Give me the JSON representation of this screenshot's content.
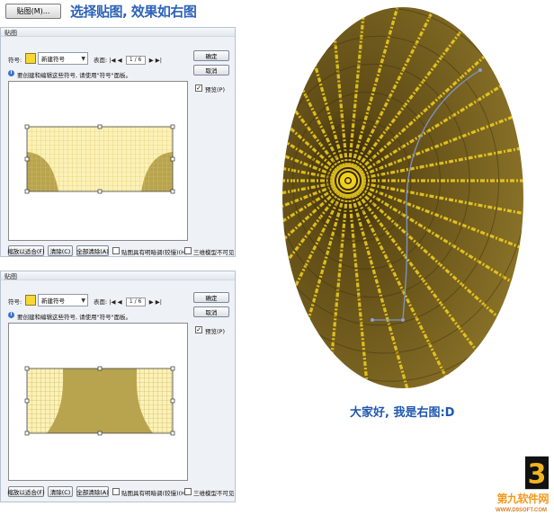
{
  "header": {
    "map_button_label": "贴图(M)...",
    "caption": "选择贴图, 效果如右图"
  },
  "dialogs": [
    {
      "title": "贴图",
      "symbol_label": "符号:",
      "symbol_name": "新建符号",
      "surface_label": "表面:",
      "page": "1 / 6",
      "info": "要创建和编辑这些符号, 请使用\"符号\"面板。",
      "ok": "确定",
      "cancel": "取消",
      "preview_label": "预览(P)",
      "preview_checked": "✓",
      "fit_btn": "缩放以适合(F)",
      "clear_btn": "清除(C)",
      "clear_all_btn": "全部清除(A)",
      "shade_label": "贴图具有明暗调(较慢)(H)",
      "invisible_label": "三维模型不可见"
    },
    {
      "title": "贴图",
      "symbol_label": "符号:",
      "symbol_name": "新建符号",
      "surface_label": "表面:",
      "page": "1 / 6",
      "info": "要创建和编辑这些符号, 请使用\"符号\"面板。",
      "ok": "确定",
      "cancel": "取消",
      "preview_label": "预览(P)",
      "preview_checked": "✓",
      "fit_btn": "缩放以适合(F)",
      "clear_btn": "清除(C)",
      "clear_all_btn": "全部清除(A)",
      "shade_label": "贴图具有明暗调(较慢)(H)",
      "invisible_label": "三维模型不可见"
    }
  ],
  "nav_symbols": {
    "first": "|◀",
    "prev": "◀",
    "next": "▶",
    "last": "▶|"
  },
  "right": {
    "caption": "大家好, 我是右图:D"
  },
  "watermark": {
    "digit": "3",
    "text": "第九软件网",
    "url": "WWW.D9SOFT.COM"
  },
  "colors": {
    "binary_gold": "#f3d21e",
    "tunnel_brown": "#7a6422",
    "swatch_yellow": "#f7d736",
    "caption_blue": "#2c62b8"
  }
}
